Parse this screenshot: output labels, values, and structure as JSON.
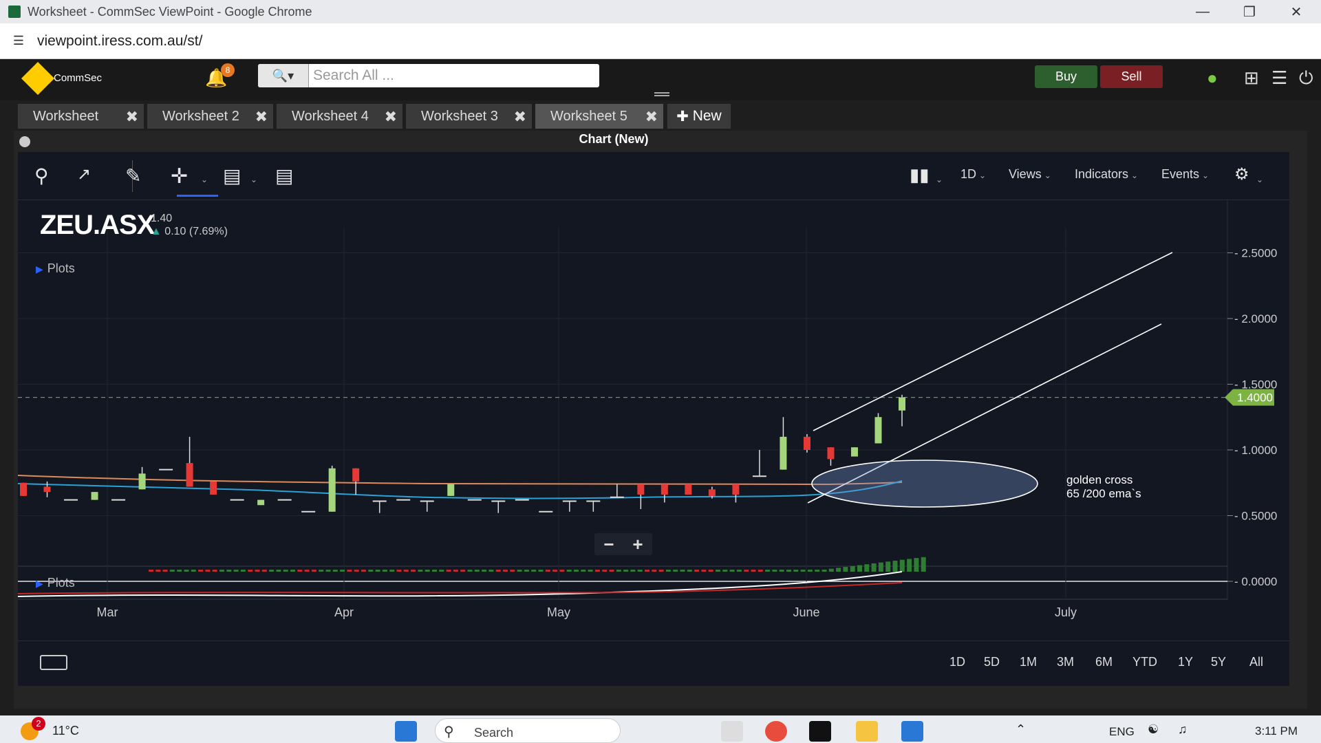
{
  "browser": {
    "window_title": "Worksheet - CommSec ViewPoint - Google Chrome",
    "url": "viewpoint.iress.com.au/st/"
  },
  "header": {
    "logo_text": "CommSec",
    "notifications_count": "8",
    "search_placeholder": "Search All ...",
    "buy_label": "Buy",
    "sell_label": "Sell"
  },
  "tabs": [
    {
      "label": "Worksheet"
    },
    {
      "label": "Worksheet 2"
    },
    {
      "label": "Worksheet 4"
    },
    {
      "label": "Worksheet 3"
    },
    {
      "label": "Worksheet 5"
    }
  ],
  "new_tab_label": "New",
  "chart_window": {
    "title": "Chart (New)",
    "toolbar": {
      "interval": "1D",
      "views": "Views",
      "indicators": "Indicators",
      "events": "Events"
    },
    "symbol": "ZEU.ASX",
    "last_price": "1.40",
    "change": "0.10 (7.69%)",
    "plots_label": "Plots",
    "price_tag": "1.4000",
    "annotation_line1": "golden cross",
    "annotation_line2": "65 /200 ema`s",
    "ranges": [
      "1D",
      "5D",
      "1M",
      "3M",
      "6M",
      "YTD",
      "1Y",
      "5Y",
      "All"
    ]
  },
  "chart_data": {
    "type": "candlestick",
    "symbol": "ZEU.ASX",
    "x_labels": [
      "Mar",
      "Apr",
      "May",
      "June",
      "July"
    ],
    "y_ticks": [
      "2.5000",
      "2.0000",
      "1.5000",
      "1.0000",
      "0.5000",
      "0.0000"
    ],
    "ylim": [
      0,
      2.5
    ],
    "last_price": 1.4,
    "candles": [
      {
        "o": 0.75,
        "c": 0.65,
        "h": 0.75,
        "l": 0.65
      },
      {
        "o": 0.72,
        "c": 0.68,
        "h": 0.76,
        "l": 0.64
      },
      {
        "o": 0.62,
        "c": 0.62,
        "h": 0.62,
        "l": 0.62
      },
      {
        "o": 0.62,
        "c": 0.68,
        "h": 0.68,
        "l": 0.62
      },
      {
        "o": 0.62,
        "c": 0.62,
        "h": 0.62,
        "l": 0.62
      },
      {
        "o": 0.7,
        "c": 0.82,
        "h": 0.87,
        "l": 0.7
      },
      {
        "o": 0.85,
        "c": 0.85,
        "h": 0.85,
        "l": 0.85
      },
      {
        "o": 0.9,
        "c": 0.72,
        "h": 1.1,
        "l": 0.72
      },
      {
        "o": 0.76,
        "c": 0.66,
        "h": 0.76,
        "l": 0.66
      },
      {
        "o": 0.62,
        "c": 0.62,
        "h": 0.62,
        "l": 0.62
      },
      {
        "o": 0.58,
        "c": 0.62,
        "h": 0.62,
        "l": 0.58
      },
      {
        "o": 0.62,
        "c": 0.62,
        "h": 0.62,
        "l": 0.62
      },
      {
        "o": 0.53,
        "c": 0.53,
        "h": 0.53,
        "l": 0.53
      },
      {
        "o": 0.53,
        "c": 0.86,
        "h": 0.88,
        "l": 0.53
      },
      {
        "o": 0.86,
        "c": 0.76,
        "h": 0.86,
        "l": 0.66
      },
      {
        "o": 0.61,
        "c": 0.61,
        "h": 0.61,
        "l": 0.52
      },
      {
        "o": 0.62,
        "c": 0.62,
        "h": 0.62,
        "l": 0.62
      },
      {
        "o": 0.61,
        "c": 0.61,
        "h": 0.61,
        "l": 0.53
      },
      {
        "o": 0.65,
        "c": 0.74,
        "h": 0.74,
        "l": 0.65
      },
      {
        "o": 0.62,
        "c": 0.62,
        "h": 0.62,
        "l": 0.62
      },
      {
        "o": 0.61,
        "c": 0.61,
        "h": 0.61,
        "l": 0.52
      },
      {
        "o": 0.62,
        "c": 0.62,
        "h": 0.62,
        "l": 0.62
      },
      {
        "o": 0.53,
        "c": 0.53,
        "h": 0.53,
        "l": 0.53
      },
      {
        "o": 0.61,
        "c": 0.61,
        "h": 0.61,
        "l": 0.53
      },
      {
        "o": 0.61,
        "c": 0.61,
        "h": 0.61,
        "l": 0.53
      },
      {
        "o": 0.64,
        "c": 0.64,
        "h": 0.74,
        "l": 0.64
      },
      {
        "o": 0.74,
        "c": 0.66,
        "h": 0.74,
        "l": 0.55
      },
      {
        "o": 0.74,
        "c": 0.66,
        "h": 0.74,
        "l": 0.6
      },
      {
        "o": 0.74,
        "c": 0.66,
        "h": 0.74,
        "l": 0.66
      },
      {
        "o": 0.7,
        "c": 0.65,
        "h": 0.72,
        "l": 0.63
      },
      {
        "o": 0.74,
        "c": 0.66,
        "h": 0.74,
        "l": 0.6
      },
      {
        "o": 0.8,
        "c": 0.8,
        "h": 1.0,
        "l": 0.8
      },
      {
        "o": 0.85,
        "c": 1.1,
        "h": 1.25,
        "l": 0.85
      },
      {
        "o": 1.1,
        "c": 1.0,
        "h": 1.12,
        "l": 0.98
      },
      {
        "o": 1.02,
        "c": 0.93,
        "h": 1.02,
        "l": 0.88
      },
      {
        "o": 0.95,
        "c": 1.02,
        "h": 1.02,
        "l": 0.95
      },
      {
        "o": 1.05,
        "c": 1.25,
        "h": 1.28,
        "l": 1.05
      },
      {
        "o": 1.3,
        "c": 1.4,
        "h": 1.42,
        "l": 1.18
      }
    ]
  },
  "taskbar": {
    "temperature": "11°C",
    "weather_badge": "2",
    "search_label": "Search",
    "language": "ENG",
    "time": "3:11 PM"
  }
}
